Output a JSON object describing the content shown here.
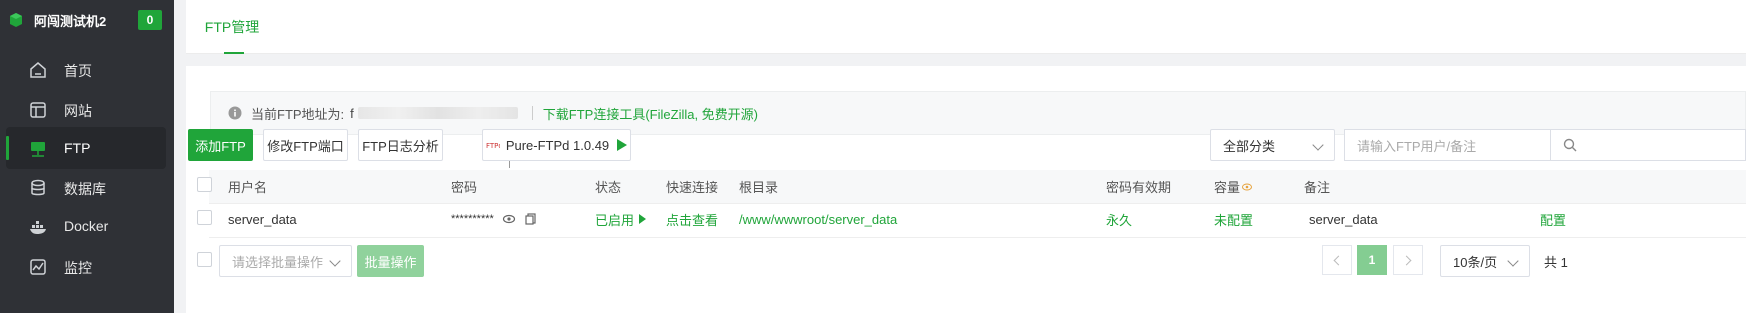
{
  "sidebar": {
    "brand_name": "阿闯测试机2",
    "badge_count": "0",
    "items": [
      {
        "label": "首页",
        "icon": "home-icon"
      },
      {
        "label": "网站",
        "icon": "website-icon"
      },
      {
        "label": "FTP",
        "icon": "ftp-icon",
        "active": true
      },
      {
        "label": "数据库",
        "icon": "database-icon"
      },
      {
        "label": "Docker",
        "icon": "docker-icon"
      },
      {
        "label": "监控",
        "icon": "monitor-icon"
      }
    ]
  },
  "tabs": [
    {
      "label": "FTP管理",
      "active": true
    }
  ],
  "notice": {
    "prefix": "当前FTP地址为:",
    "address_visible": "f",
    "download_link": "下载FTP连接工具(FileZilla, 免费开源)"
  },
  "toolbar": {
    "add_label": "添加FTP",
    "modify_port_label": "修改FTP端口",
    "log_analysis_label": "FTP日志分析",
    "service_label": "Pure-FTPd 1.0.49",
    "category_select": "全部分类",
    "search_placeholder": "请输入FTP用户/备注"
  },
  "table": {
    "headers": [
      "用户名",
      "密码",
      "状态",
      "快速连接",
      "根目录",
      "密码有效期",
      "容量",
      "备注"
    ],
    "rows": [
      {
        "username": "server_data",
        "password": "**********",
        "status": "已启用",
        "quick_connect": "点击查看",
        "root_dir": "/www/wwwroot/server_data",
        "expiry": "永久",
        "capacity": "未配置",
        "remark": "server_data",
        "action": "配置"
      }
    ]
  },
  "footer": {
    "batch_placeholder": "请选择批量操作",
    "batch_button": "批量操作",
    "current_page": "1",
    "page_size": "10条/页",
    "total": "共 1"
  },
  "colors": {
    "accent": "#20a53a",
    "sidebar_bg": "#2f3136"
  }
}
